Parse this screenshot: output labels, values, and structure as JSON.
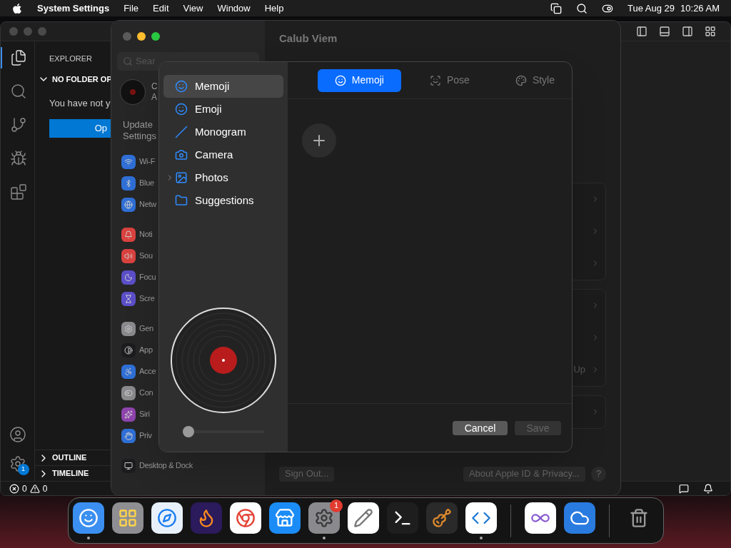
{
  "menu_bar": {
    "app": "System Settings",
    "menus": [
      "File",
      "Edit",
      "View",
      "Window",
      "Help"
    ],
    "date": "Tue Aug 29",
    "time": "10:26 AM"
  },
  "code_editor": {
    "activity": [
      {
        "kind": "files",
        "selected": true
      },
      {
        "kind": "search",
        "selected": false
      },
      {
        "kind": "source-control",
        "selected": false
      },
      {
        "kind": "run-debug",
        "selected": false
      },
      {
        "kind": "extensions",
        "selected": false
      }
    ],
    "explorer_title": "EXPLORER",
    "section": {
      "title": "NO FOLDER OP",
      "expanded": true
    },
    "message": "You have not y",
    "open_button": "Op",
    "panels": [
      {
        "title": "OUTLINE",
        "expanded": false
      },
      {
        "title": "TIMELINE",
        "expanded": false
      }
    ],
    "settings_badge": "1",
    "status": {
      "errors": "0",
      "warnings": "0"
    }
  },
  "settings_window": {
    "title": "Calub Viem",
    "search_placeholder": "Sear",
    "account": {
      "name": "C",
      "subtitle": "A"
    },
    "update_notice": [
      "Update",
      "Settings"
    ],
    "sidebar_groups": [
      [
        {
          "label": "Wi-F",
          "kind": "wifi",
          "color": "#2f6fd6"
        },
        {
          "label": "Blue",
          "kind": "bluetooth",
          "color": "#2f6fd6"
        },
        {
          "label": "Netw",
          "kind": "network",
          "color": "#2f6fd6"
        }
      ],
      [
        {
          "label": "Noti",
          "kind": "notifications",
          "color": "#d9423f"
        },
        {
          "label": "Sou",
          "kind": "sound",
          "color": "#d9423f"
        },
        {
          "label": "Focu",
          "kind": "focus",
          "color": "#5b4fc9"
        },
        {
          "label": "Scre",
          "kind": "screen-time",
          "color": "#5b4fc9"
        }
      ],
      [
        {
          "label": "Gen",
          "kind": "general",
          "color": "#8a8a8e"
        },
        {
          "label": "App",
          "kind": "appearance",
          "color": "#1c1c1e"
        },
        {
          "label": "Acce",
          "kind": "accessibility",
          "color": "#2f6fd6"
        },
        {
          "label": "Con",
          "kind": "control-centre",
          "color": "#8a8a8e"
        },
        {
          "label": "Siri",
          "kind": "siri",
          "color": "#8e44ad"
        },
        {
          "label": "Priv",
          "kind": "privacy",
          "color": "#2f6fd6"
        }
      ],
      [
        {
          "label": "Desktop & Dock",
          "kind": "desktop",
          "color": "#1c1c1e"
        }
      ]
    ],
    "groups": [
      {
        "rows": [
          "",
          "",
          ""
        ]
      },
      {
        "rows": [
          "",
          "",
          "Up"
        ]
      },
      {
        "rows": [
          ""
        ]
      }
    ],
    "sign_out": "Sign Out...",
    "about": "About Apple ID & Privacy...",
    "help": "?"
  },
  "dialog": {
    "sources": [
      {
        "label": "Memoji",
        "kind": "memoji",
        "selected": true,
        "expandable": false
      },
      {
        "label": "Emoji",
        "kind": "emoji",
        "selected": false,
        "expandable": false
      },
      {
        "label": "Monogram",
        "kind": "monogram",
        "selected": false,
        "expandable": false
      },
      {
        "label": "Camera",
        "kind": "camera",
        "selected": false,
        "expandable": false
      },
      {
        "label": "Photos",
        "kind": "photos",
        "selected": false,
        "expandable": true
      },
      {
        "label": "Suggestions",
        "kind": "suggestions",
        "selected": false,
        "expandable": false
      }
    ],
    "zoom": {
      "level": 0.0
    },
    "tabs": [
      {
        "label": "Memoji",
        "kind": "memoji",
        "selected": true
      },
      {
        "label": "Pose",
        "kind": "pose",
        "selected": false
      },
      {
        "label": "Style",
        "kind": "style",
        "selected": false
      }
    ],
    "cancel": "Cancel",
    "save": {
      "label": "Save",
      "disabled": true
    }
  },
  "dock": {
    "apps": [
      {
        "kind": "finder",
        "running": true
      },
      {
        "kind": "launchpad",
        "running": false
      },
      {
        "kind": "safari",
        "running": false
      },
      {
        "kind": "firefox",
        "running": false
      },
      {
        "kind": "chrome",
        "running": false
      },
      {
        "kind": "app-store",
        "running": false
      },
      {
        "kind": "settings",
        "running": true,
        "badge": "1"
      },
      {
        "kind": "textedit",
        "running": false
      },
      {
        "kind": "terminal",
        "running": false
      },
      {
        "kind": "garageband",
        "running": false
      },
      {
        "kind": "vscode",
        "running": true
      },
      {
        "kind": "divider"
      },
      {
        "kind": "visual-studio",
        "running": false
      },
      {
        "kind": "weather",
        "running": false
      },
      {
        "kind": "divider"
      },
      {
        "kind": "trash",
        "running": false
      }
    ]
  }
}
